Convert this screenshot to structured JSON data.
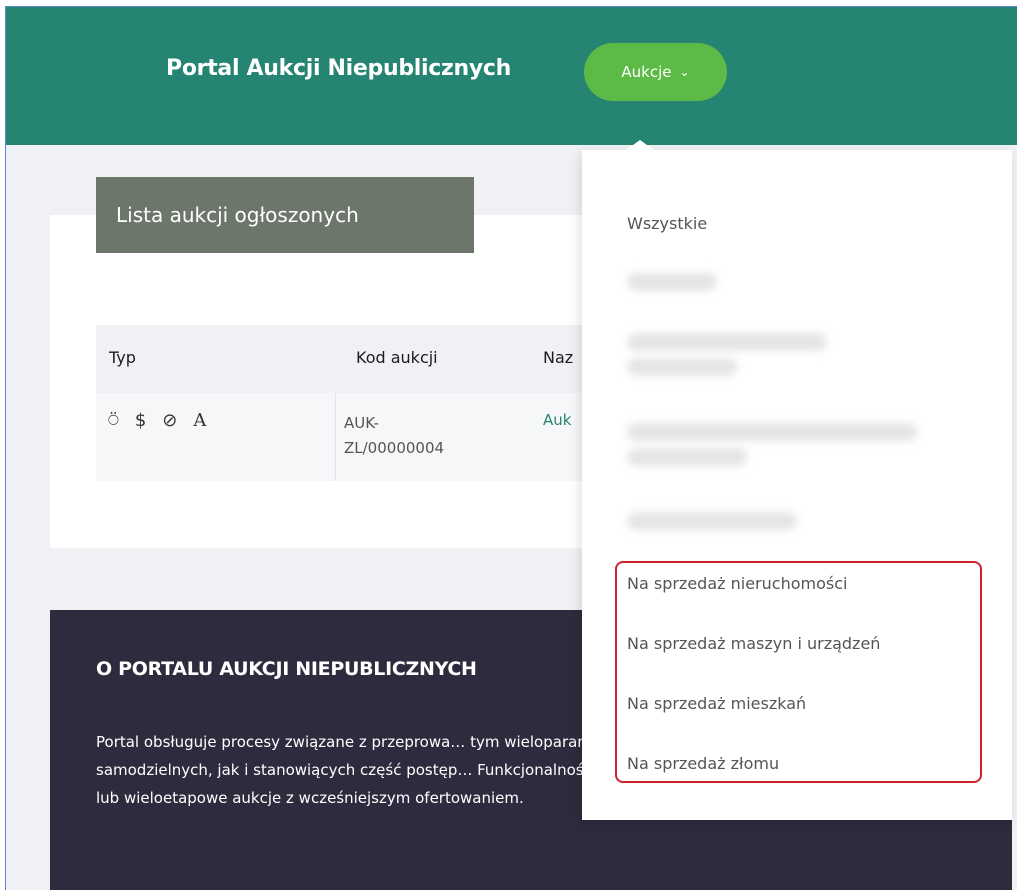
{
  "header": {
    "brand": "Portal Aukcji Niepublicznych",
    "menu_button": "Aukcje",
    "menu_chevron": "⌄"
  },
  "card": {
    "title": "Lista aukcji ogłoszonych",
    "columns": [
      "Typ",
      "Kod aukcji",
      "Naz"
    ],
    "rows": [
      {
        "type_icons": [
          "lock-open-icon",
          "dollar-icon",
          "eye-off-icon",
          "letter-a-icon"
        ],
        "type_glyphs": [
          "⍥",
          "$",
          "⊘",
          "A"
        ],
        "code": "AUK-ZL/00000004",
        "name": "Auk"
      }
    ]
  },
  "footer": {
    "title": "O PORTALU AUKCJI NIEPUBLICZNYCH",
    "text": "Portal obsługuje procesy związane z przeprowa… tym wieloparametrowych, wraz z kryteriami poz… samodzielnych, jak i stanowiących część postęp… Funkcjonalność portalu pozwala również przeprowadzać jedno lub wieloetapowe aukcje z wcześniejszym ofertowaniem."
  },
  "dropdown": {
    "items": [
      "Wszystkie",
      "Na sprzedaż nieruchomości",
      "Na sprzedaż maszyn i urządzeń",
      "Na sprzedaż mieszkań",
      "Na sprzedaż złomu"
    ]
  },
  "colors": {
    "header_bg": "#258472",
    "button_green": "#5cba47",
    "title_bg": "#6d766b",
    "footer_bg": "#2c2c3e",
    "highlight_red": "#d0212b"
  }
}
